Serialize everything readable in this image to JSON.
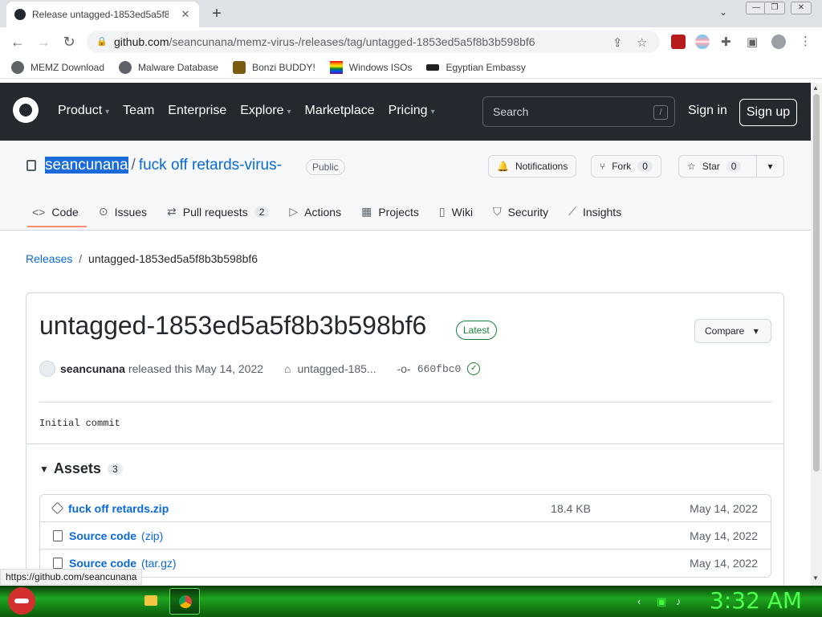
{
  "browser": {
    "tab_title": "Release untagged-1853ed5a5f8b3b598bf6",
    "url_host": "github.com",
    "url_path": "/seancunana/memz-virus-/releases/tag/untagged-1853ed5a5f8b3b598bf6",
    "status_url": "https://github.com/seancunana",
    "bookmarks": [
      "MEMZ Download",
      "Malware Database",
      "Bonzi BUDDY!",
      "Windows ISOs",
      "Egyptian Embassy"
    ]
  },
  "gh_header": {
    "nav": [
      "Product",
      "Team",
      "Enterprise",
      "Explore",
      "Marketplace",
      "Pricing"
    ],
    "search_placeholder": "Search",
    "search_key": "/",
    "signin": "Sign in",
    "signup": "Sign up"
  },
  "repo": {
    "owner": "seancunana",
    "separator": "/",
    "name": "fuck off retards-virus-",
    "visibility": "Public",
    "notifications": "Notifications",
    "fork_label": "Fork",
    "fork_count": "0",
    "star_label": "Star",
    "star_count": "0",
    "tabs": [
      {
        "label": "Code",
        "count": ""
      },
      {
        "label": "Issues",
        "count": ""
      },
      {
        "label": "Pull requests",
        "count": "2"
      },
      {
        "label": "Actions",
        "count": ""
      },
      {
        "label": "Projects",
        "count": ""
      },
      {
        "label": "Wiki",
        "count": ""
      },
      {
        "label": "Security",
        "count": ""
      },
      {
        "label": "Insights",
        "count": ""
      }
    ]
  },
  "breadcrumb": {
    "releases": "Releases",
    "sep": "/",
    "current": "untagged-1853ed5a5f8b3b598bf6"
  },
  "release": {
    "title": "untagged-1853ed5a5f8b3b598bf6",
    "badge": "Latest",
    "compare": "Compare",
    "author": "seancunana",
    "released_text": "released this May 14, 2022",
    "tag": "untagged-185...",
    "commit": "660fbc0",
    "body": "Initial commit",
    "assets_label": "Assets",
    "assets_count": "3",
    "assets": [
      {
        "name": "fuck off retards.zip",
        "ext": "",
        "size": "18.4 KB",
        "date": "May 14, 2022"
      },
      {
        "name": "Source code",
        "ext": "(zip)",
        "size": "",
        "date": "May 14, 2022"
      },
      {
        "name": "Source code",
        "ext": "(tar.gz)",
        "size": "",
        "date": "May 14, 2022"
      }
    ]
  },
  "taskbar": {
    "clock": "3:32 AM"
  }
}
